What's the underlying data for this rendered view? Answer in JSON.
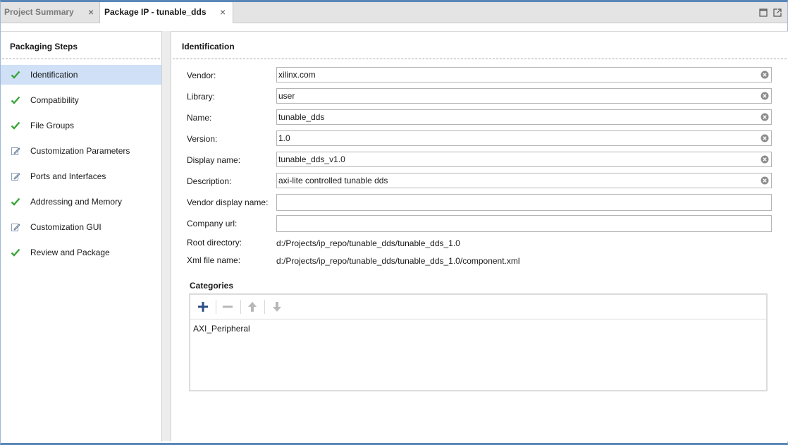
{
  "tabs": [
    {
      "label": "Project Summary",
      "close": "×"
    },
    {
      "label": "Package IP - tunable_dds",
      "close": "×"
    }
  ],
  "steps_panel": {
    "title": "Packaging Steps",
    "items": [
      {
        "label": "Identification",
        "status": "check",
        "active": true
      },
      {
        "label": "Compatibility",
        "status": "check"
      },
      {
        "label": "File Groups",
        "status": "check"
      },
      {
        "label": "Customization Parameters",
        "status": "edit"
      },
      {
        "label": "Ports and Interfaces",
        "status": "edit"
      },
      {
        "label": "Addressing and Memory",
        "status": "check"
      },
      {
        "label": "Customization GUI",
        "status": "edit"
      },
      {
        "label": "Review and Package",
        "status": "check"
      }
    ]
  },
  "identification": {
    "title": "Identification",
    "fields": [
      {
        "label": "Vendor:",
        "value": "xilinx.com",
        "clearable": true
      },
      {
        "label": "Library:",
        "value": "user",
        "clearable": true
      },
      {
        "label": "Name:",
        "value": "tunable_dds",
        "clearable": true
      },
      {
        "label": "Version:",
        "value": "1.0",
        "clearable": true
      },
      {
        "label": "Display name:",
        "value": "tunable_dds_v1.0",
        "clearable": true
      },
      {
        "label": "Description:",
        "value": "axi-lite controlled tunable dds",
        "clearable": true
      },
      {
        "label": "Vendor display name:",
        "value": "",
        "clearable": false
      },
      {
        "label": "Company url:",
        "value": "",
        "clearable": false
      }
    ],
    "root_directory": {
      "label": "Root directory:",
      "value": "d:/Projects/ip_repo/tunable_dds/tunable_dds_1.0"
    },
    "xml_file": {
      "label": "Xml file name:",
      "value": "d:/Projects/ip_repo/tunable_dds/tunable_dds_1.0/component.xml"
    }
  },
  "categories": {
    "title": "Categories",
    "items": [
      "AXI_Peripheral"
    ]
  },
  "colors": {
    "accent": "#5a86b8",
    "check": "#3aa63a",
    "active_row": "#cfe0f7",
    "add_icon": "#2c4f86"
  }
}
